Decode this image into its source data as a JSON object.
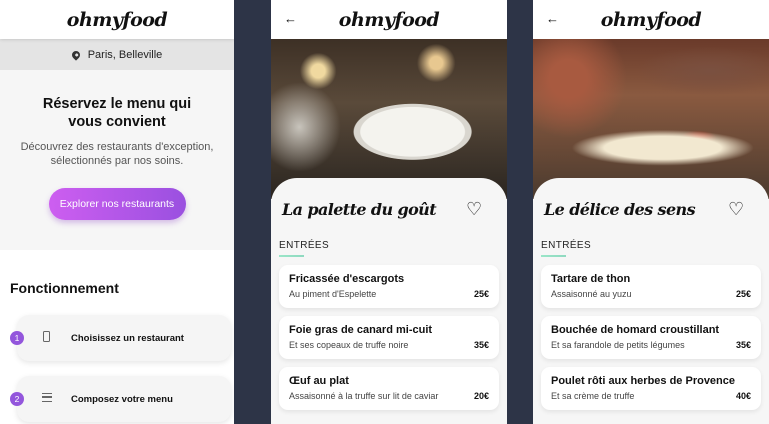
{
  "brand": "ohmyfood",
  "home": {
    "location": "Paris, Belleville",
    "hero_title": "Réservez le menu qui vous convient",
    "hero_text": "Découvrez des restaurants d'exception, sélectionnés par nos soins.",
    "cta_label": "Explorer nos restaurants",
    "how_title": "Fonctionnement",
    "steps": [
      {
        "num": "1",
        "icon": "phone-icon",
        "label": "Choisissez un restaurant"
      },
      {
        "num": "2",
        "icon": "list-icon",
        "label": "Composez votre menu"
      }
    ]
  },
  "restaurants": [
    {
      "name": "La palette du goût",
      "section": "ENTRÉES",
      "dishes": [
        {
          "name": "Fricassée d'escargots",
          "desc": "Au piment d'Espelette",
          "price": "25€"
        },
        {
          "name": "Foie gras de canard mi-cuit",
          "desc": "Et ses copeaux de truffe noire",
          "price": "35€"
        },
        {
          "name": "Œuf au plat",
          "desc": "Assaisonné à la truffe sur lit de caviar",
          "price": "20€"
        }
      ]
    },
    {
      "name": "Le délice des sens",
      "section": "ENTRÉES",
      "dishes": [
        {
          "name": "Tartare de thon",
          "desc": "Assaisonné au yuzu",
          "price": "25€"
        },
        {
          "name": "Bouchée de homard croustillant",
          "desc": "Et sa farandole de petits légumes",
          "price": "35€"
        },
        {
          "name": "Poulet rôti aux herbes de Provence",
          "desc": "Et sa crème de truffe",
          "price": "40€"
        }
      ]
    }
  ],
  "icons": {
    "back": "arrow-left-icon",
    "favorite": "heart-icon",
    "location": "map-pin-icon"
  },
  "colors": {
    "accent_from": "#cd5ef0",
    "accent_to": "#9a50e0",
    "section_line": "#9ae6c8",
    "gutter": "#2d3447"
  }
}
